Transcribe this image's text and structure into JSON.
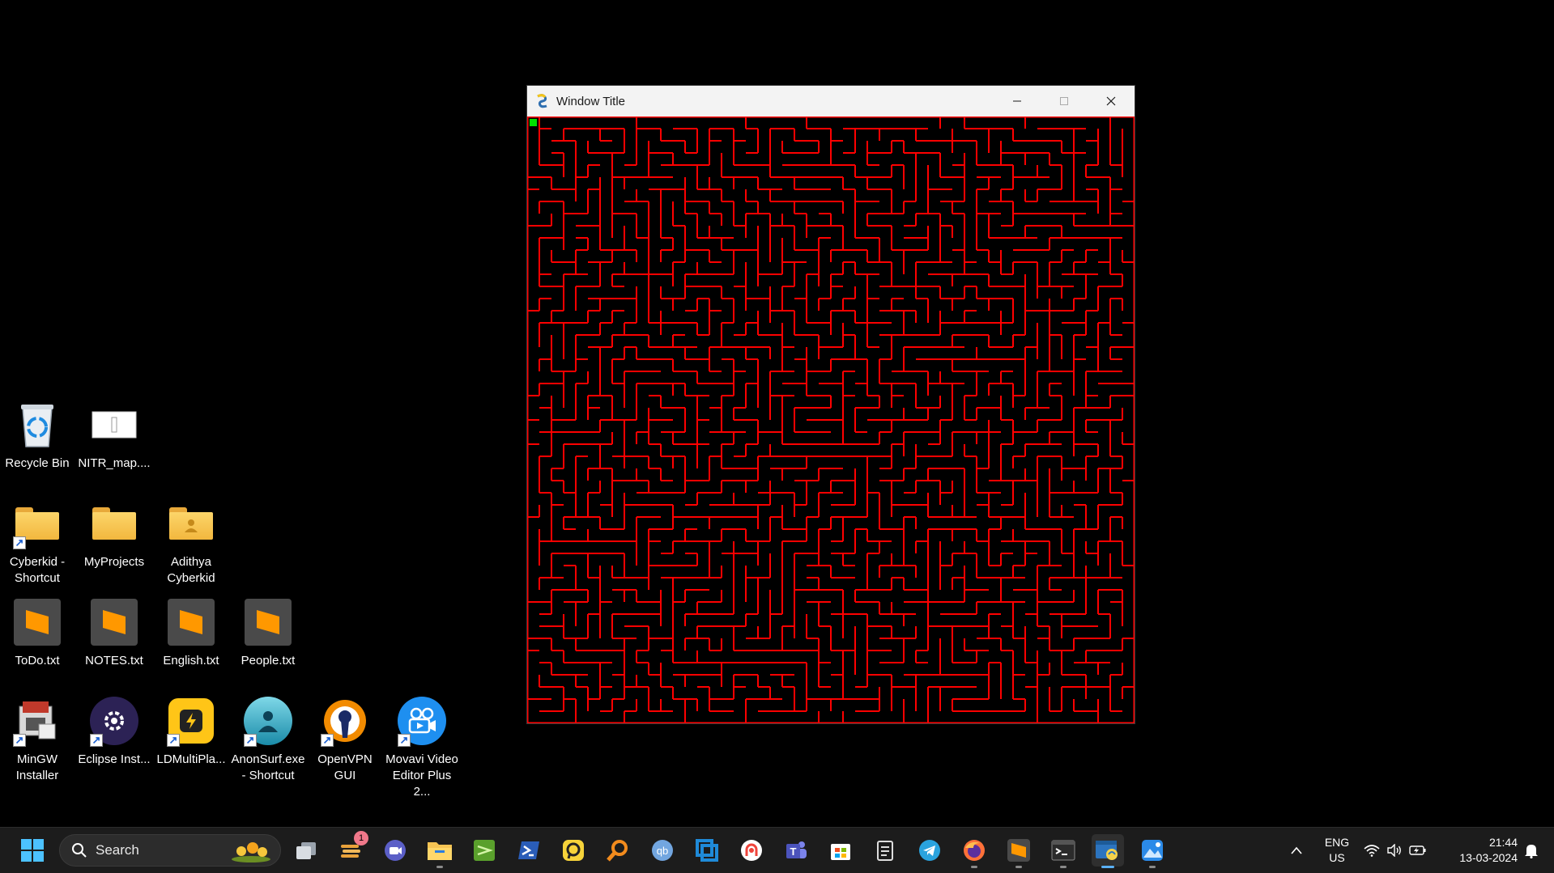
{
  "desktop": {
    "icons": [
      {
        "label": "Recycle Bin"
      },
      {
        "label": "NITR_map...."
      },
      {
        "label": "Cyberkid -\nShortcut"
      },
      {
        "label": "MyProjects"
      },
      {
        "label": "Adithya\nCyberkid"
      },
      {
        "label": "ToDo.txt"
      },
      {
        "label": "NOTES.txt"
      },
      {
        "label": "English.txt"
      },
      {
        "label": "People.txt"
      },
      {
        "label": "MinGW\nInstaller"
      },
      {
        "label": "Eclipse Inst..."
      },
      {
        "label": "LDMultiPla..."
      },
      {
        "label": "AnonSurf.exe\n- Shortcut"
      },
      {
        "label": "OpenVPN\nGUI"
      },
      {
        "label": "Movavi Video\nEditor Plus 2..."
      }
    ]
  },
  "window": {
    "title": "Window Title",
    "icon": "pygame-snake-icon",
    "controls": [
      "minimize-icon",
      "maximize-icon",
      "close-icon"
    ],
    "maze": {
      "wall_color": "#ff0000",
      "background": "#000000",
      "start_marker_color": "#00e000"
    }
  },
  "taskbar": {
    "search_label": "Search",
    "widget_badge": "1",
    "apps": [
      "task-view",
      "widgets",
      "meet",
      "file-explorer",
      "terminal-green",
      "powershell",
      "pcloud",
      "everything-search",
      "qbittorrent",
      "virtualbox",
      "anydesk",
      "teams",
      "microsoft-store",
      "notepad",
      "telegram",
      "firefox",
      "sublime-text",
      "cmd",
      "python",
      "photos"
    ],
    "tray": {
      "language": "ENG",
      "region": "US",
      "time": "21:44",
      "date": "13-03-2024"
    }
  },
  "colors": {
    "taskbar": "#1c1c1c",
    "accent": "#5ab0f5",
    "maze_wall": "#ff0000"
  }
}
